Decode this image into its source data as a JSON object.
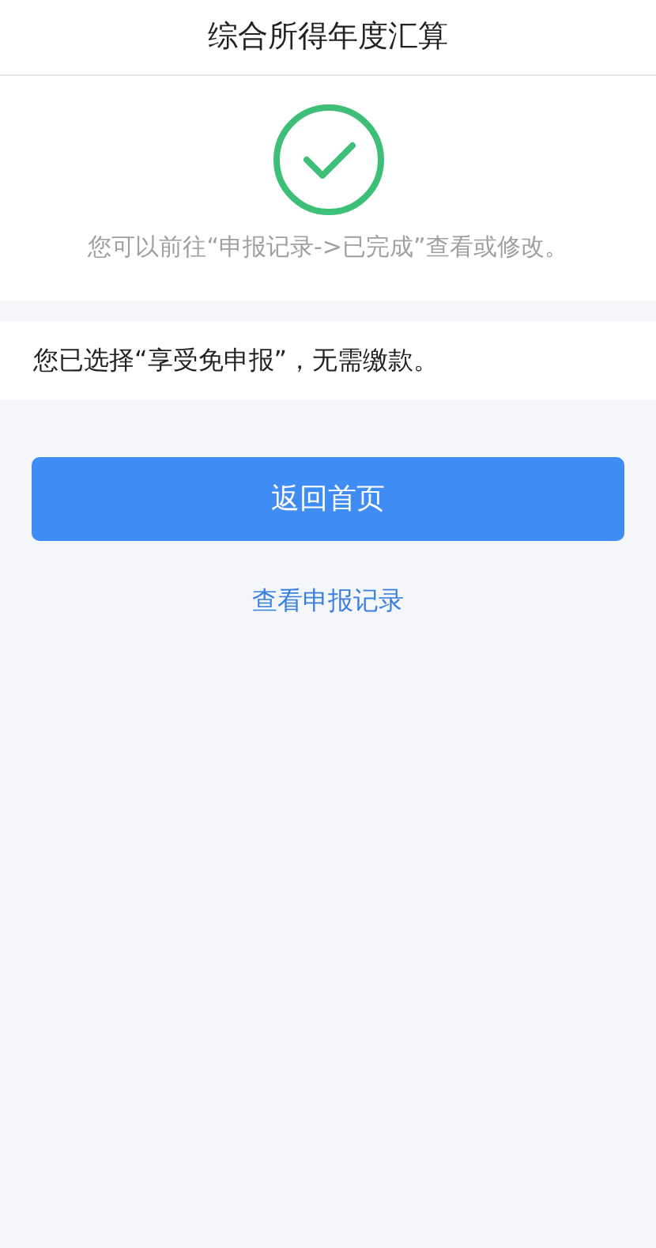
{
  "header": {
    "title": "综合所得年度汇算"
  },
  "status": {
    "message": "您可以前往“申报记录->已完成”查看或修改。"
  },
  "result": {
    "text": "您已选择“享受免申报”，无需缴款。"
  },
  "primary_button": {
    "label": "返回首页"
  },
  "link": {
    "label": "查看申报记录"
  }
}
